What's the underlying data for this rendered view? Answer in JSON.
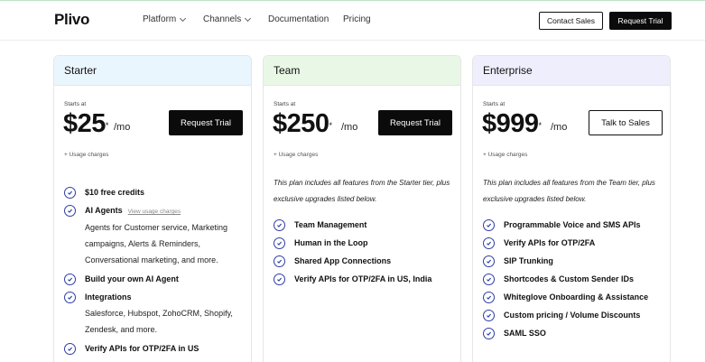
{
  "nav": {
    "logo": "Plivo",
    "items": [
      "Platform",
      "Channels",
      "Documentation",
      "Pricing"
    ],
    "contact_label": "Contact Sales",
    "trial_label": "Request Trial"
  },
  "plans": [
    {
      "name": "Starter",
      "starts_at": "Starts at",
      "price": "$25",
      "asterisk": "*",
      "per": "/mo",
      "button": "Request Trial",
      "usage": "+ Usage charges",
      "features": [
        {
          "text": "$10 free credits"
        },
        {
          "text": "AI Agents",
          "link": "View usage charges",
          "sub": "Agents for Customer service, Marketing campaigns, Alerts & Reminders, Conversational marketing, and more."
        },
        {
          "text": "Build your own AI Agent"
        },
        {
          "text": "Integrations",
          "sub": "Salesforce, Hubspot, ZohoCRM, Shopify, Zendesk, and more."
        },
        {
          "text": "Verify APIs for OTP/2FA in US"
        }
      ]
    },
    {
      "name": "Team",
      "starts_at": "Starts at",
      "price": "$250",
      "asterisk": "*",
      "per": "/mo",
      "button": "Request Trial",
      "usage": "+ Usage charges",
      "description": "This plan includes all features from the Starter tier, plus exclusive upgrades listed below.",
      "features": [
        {
          "text": "Team Management"
        },
        {
          "text": "Human in the Loop"
        },
        {
          "text": "Shared App Connections"
        },
        {
          "text": "Verify APIs for OTP/2FA in US, India"
        }
      ]
    },
    {
      "name": "Enterprise",
      "starts_at": "Starts at",
      "price": "$999",
      "asterisk": "*",
      "per": "/mo",
      "button": "Talk to Sales",
      "usage": "+ Usage charges",
      "description": "This plan includes all features from the Team tier, plus exclusive upgrades listed below.",
      "features": [
        {
          "text": "Programmable Voice and SMS APIs"
        },
        {
          "text": "Verify APIs for OTP/2FA"
        },
        {
          "text": "SIP Trunking"
        },
        {
          "text": "Shortcodes & Custom Sender IDs"
        },
        {
          "text": "Whiteglove Onboarding & Assistance"
        },
        {
          "text": "Custom pricing / Volume Discounts"
        },
        {
          "text": "SAML SSO"
        }
      ]
    }
  ],
  "colors": {
    "starter_header": "#eaf6fd",
    "team_header": "#e9f8e6",
    "enterprise_header": "#efeefc",
    "check": "#2f3da3"
  }
}
